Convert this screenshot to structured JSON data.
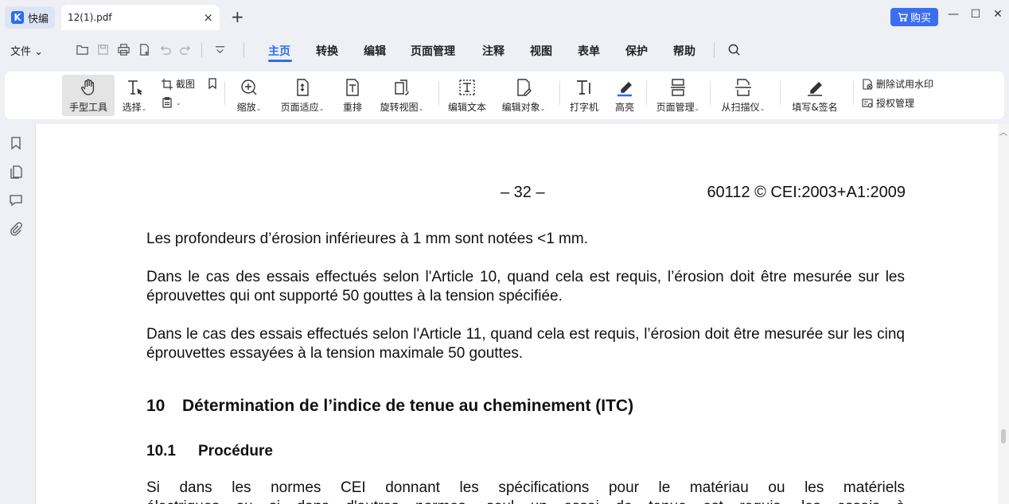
{
  "app": {
    "name": "快编"
  },
  "tab": {
    "title": "12(1).pdf",
    "close": "×",
    "new": "+"
  },
  "titlebar": {
    "buy_label": "购买",
    "minimize": "—",
    "maximize": "☐",
    "close": "✕"
  },
  "menubar": {
    "file_label": "文件",
    "items": [
      "主页",
      "转换",
      "编辑",
      "页面管理",
      "注释",
      "视图",
      "表单",
      "保护",
      "帮助"
    ],
    "active": "主页"
  },
  "ribbon": {
    "hand": "手型工具",
    "select": "选择",
    "screenshot": "截图",
    "zoom": "缩放",
    "fit": "页面适应",
    "reflow": "重排",
    "rotate": "旋转视图",
    "edit_text": "编辑文本",
    "edit_object": "编辑对象",
    "typewriter": "打字机",
    "highlight": "高亮",
    "page_manage": "页面管理",
    "from_scanner": "从扫描仪",
    "fill_sign": "填写&签名",
    "remove_watermark": "删除试用水印",
    "license": "授权管理"
  },
  "document": {
    "header_page": "– 32 –",
    "header_ref": "60112 © CEI:2003+A1:2009",
    "p1": "Les profondeurs d’érosion inférieures à 1 mm sont notées <1 mm.",
    "p2": "Dans le cas des essais effectués selon l'Article 10, quand cela est requis, l’érosion doit être mesurée sur les éprouvettes qui ont supporté 50 gouttes à la tension spécifiée.",
    "p3": "Dans le cas des essais effectués selon l'Article 11, quand cela est requis, l’érosion doit être mesurée sur les cinq éprouvettes essayées à la tension maximale 50 gouttes.",
    "h10_num": "10",
    "h10_text": "Détermination de l’indice de tenue au cheminement (ITC)",
    "h101_num": "10.1",
    "h101_text": "Procédure",
    "p4": "Si dans les normes CEI donnant les spécifications pour le matériau ou les matériels",
    "p5": "électriques ou si dans d'autres normes, seul un essai de tenue est requis, les essais à"
  }
}
